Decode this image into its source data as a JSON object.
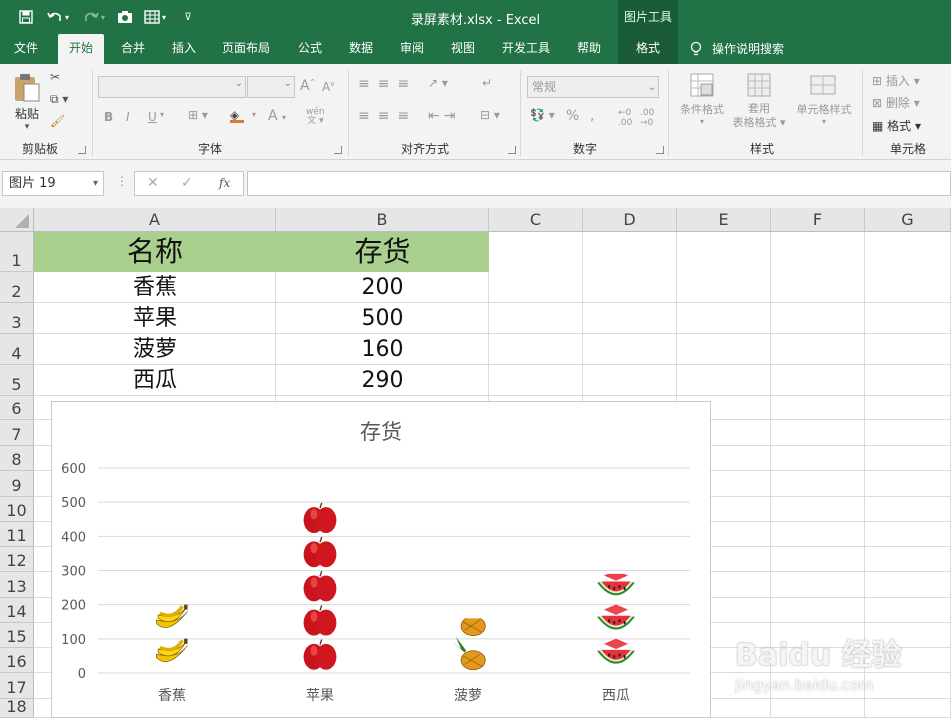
{
  "titlebar": {
    "doc_title": "录屏素材.xlsx  -  Excel",
    "context_group": "图片工具"
  },
  "tabs": [
    {
      "label": "文件",
      "active": false
    },
    {
      "label": "开始",
      "active": true
    },
    {
      "label": "合并",
      "active": false
    },
    {
      "label": "插入",
      "active": false
    },
    {
      "label": "页面布局",
      "active": false
    },
    {
      "label": "公式",
      "active": false
    },
    {
      "label": "数据",
      "active": false
    },
    {
      "label": "审阅",
      "active": false
    },
    {
      "label": "视图",
      "active": false
    },
    {
      "label": "开发工具",
      "active": false
    },
    {
      "label": "帮助",
      "active": false
    },
    {
      "label": "格式",
      "active": false
    }
  ],
  "tell_me": "操作说明搜索",
  "ribbon": {
    "clipboard": {
      "paste": "粘贴",
      "label": "剪贴板"
    },
    "font": {
      "label": "字体",
      "bold": "B",
      "italic": "I",
      "underline": "U",
      "font_grow": "A",
      "font_shrink": "A",
      "font_color": "A",
      "phonetic": "wén"
    },
    "alignment": {
      "label": "对齐方式"
    },
    "number": {
      "label": "数字",
      "format_value": "常规",
      "percent": "%",
      "comma": ","
    },
    "styles": {
      "label": "样式",
      "conditional": "条件格式",
      "table_format_1": "套用",
      "table_format_2": "表格格式",
      "cell_styles": "单元格样式"
    },
    "cells": {
      "label": "单元格",
      "insert": "插入",
      "delete": "删除",
      "format": "格式"
    }
  },
  "formula_bar": {
    "name_box": "图片 19",
    "fx": "fx",
    "formula": ""
  },
  "columns": [
    "A",
    "B",
    "C",
    "D",
    "E",
    "F",
    "G"
  ],
  "rows": [
    "1",
    "2",
    "3",
    "4",
    "5",
    "6",
    "7",
    "8",
    "9",
    "10",
    "11",
    "12",
    "13",
    "14",
    "15",
    "16",
    "17",
    "18"
  ],
  "table": {
    "header": [
      "名称",
      "存货"
    ],
    "rows": [
      [
        "香蕉",
        "200"
      ],
      [
        "苹果",
        "500"
      ],
      [
        "菠萝",
        "160"
      ],
      [
        "西瓜",
        "290"
      ]
    ]
  },
  "header_fill": "#a9d08e",
  "accent": "#217346",
  "chart_data": {
    "type": "bar",
    "title": "存货",
    "categories": [
      "香蕉",
      "苹果",
      "菠萝",
      "西瓜"
    ],
    "values": [
      200,
      500,
      160,
      290
    ],
    "ylim": [
      0,
      600
    ],
    "yticks": [
      "0",
      "100",
      "200",
      "300",
      "400",
      "500",
      "600"
    ],
    "grid": true,
    "picture_fill": "stacked images",
    "icons": [
      "banana-icon",
      "apple-icon",
      "pineapple-icon",
      "watermelon-icon"
    ]
  },
  "watermark": {
    "brand": "Baidu 经验",
    "url": "jingyan.baidu.com"
  }
}
